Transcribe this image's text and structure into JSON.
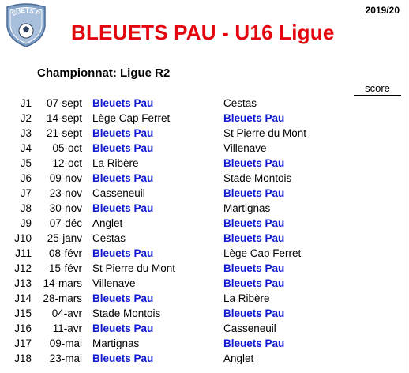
{
  "header": {
    "season": "2019/20",
    "title": "BLEUETS PAU - U16 Ligue",
    "subtitle": "Championnat: Ligue R2",
    "score_label": "score",
    "logo_text": "BLEUETS PAU",
    "highlight_color": "#0f19cf",
    "title_color": "#e3060e"
  },
  "matches": [
    {
      "day": "J1",
      "date": "07-sept",
      "home": "Bleuets Pau",
      "away": "Cestas",
      "bleuets": "home"
    },
    {
      "day": "J2",
      "date": "14-sept",
      "home": "Lège Cap Ferret",
      "away": "Bleuets Pau",
      "bleuets": "away"
    },
    {
      "day": "J3",
      "date": "21-sept",
      "home": "Bleuets Pau",
      "away": "St Pierre du Mont",
      "bleuets": "home"
    },
    {
      "day": "J4",
      "date": "05-oct",
      "home": "Bleuets Pau",
      "away": "Villenave",
      "bleuets": "home"
    },
    {
      "day": "J5",
      "date": "12-oct",
      "home": "La Ribère",
      "away": "Bleuets Pau",
      "bleuets": "away"
    },
    {
      "day": "J6",
      "date": "09-nov",
      "home": "Bleuets Pau",
      "away": "Stade Montois",
      "bleuets": "home"
    },
    {
      "day": "J7",
      "date": "23-nov",
      "home": "Casseneuil",
      "away": "Bleuets Pau",
      "bleuets": "away"
    },
    {
      "day": "J8",
      "date": "30-nov",
      "home": "Bleuets Pau",
      "away": "Martignas",
      "bleuets": "home"
    },
    {
      "day": "J9",
      "date": "07-déc",
      "home": "Anglet",
      "away": "Bleuets Pau",
      "bleuets": "away"
    },
    {
      "day": "J10",
      "date": "25-janv",
      "home": "Cestas",
      "away": "Bleuets Pau",
      "bleuets": "away"
    },
    {
      "day": "J11",
      "date": "08-févr",
      "home": "Bleuets Pau",
      "away": "Lège Cap Ferret",
      "bleuets": "home"
    },
    {
      "day": "J12",
      "date": "15-févr",
      "home": "St Pierre du Mont",
      "away": "Bleuets Pau",
      "bleuets": "away"
    },
    {
      "day": "J13",
      "date": "14-mars",
      "home": "Villenave",
      "away": "Bleuets Pau",
      "bleuets": "away"
    },
    {
      "day": "J14",
      "date": "28-mars",
      "home": "Bleuets Pau",
      "away": "La Ribère",
      "bleuets": "home"
    },
    {
      "day": "J15",
      "date": "04-avr",
      "home": "Stade Montois",
      "away": "Bleuets Pau",
      "bleuets": "away"
    },
    {
      "day": "J16",
      "date": "11-avr",
      "home": "Bleuets Pau",
      "away": "Casseneuil",
      "bleuets": "home"
    },
    {
      "day": "J17",
      "date": "09-mai",
      "home": "Martignas",
      "away": "Bleuets Pau",
      "bleuets": "away"
    },
    {
      "day": "J18",
      "date": "23-mai",
      "home": "Bleuets Pau",
      "away": "Anglet",
      "bleuets": "home"
    }
  ]
}
